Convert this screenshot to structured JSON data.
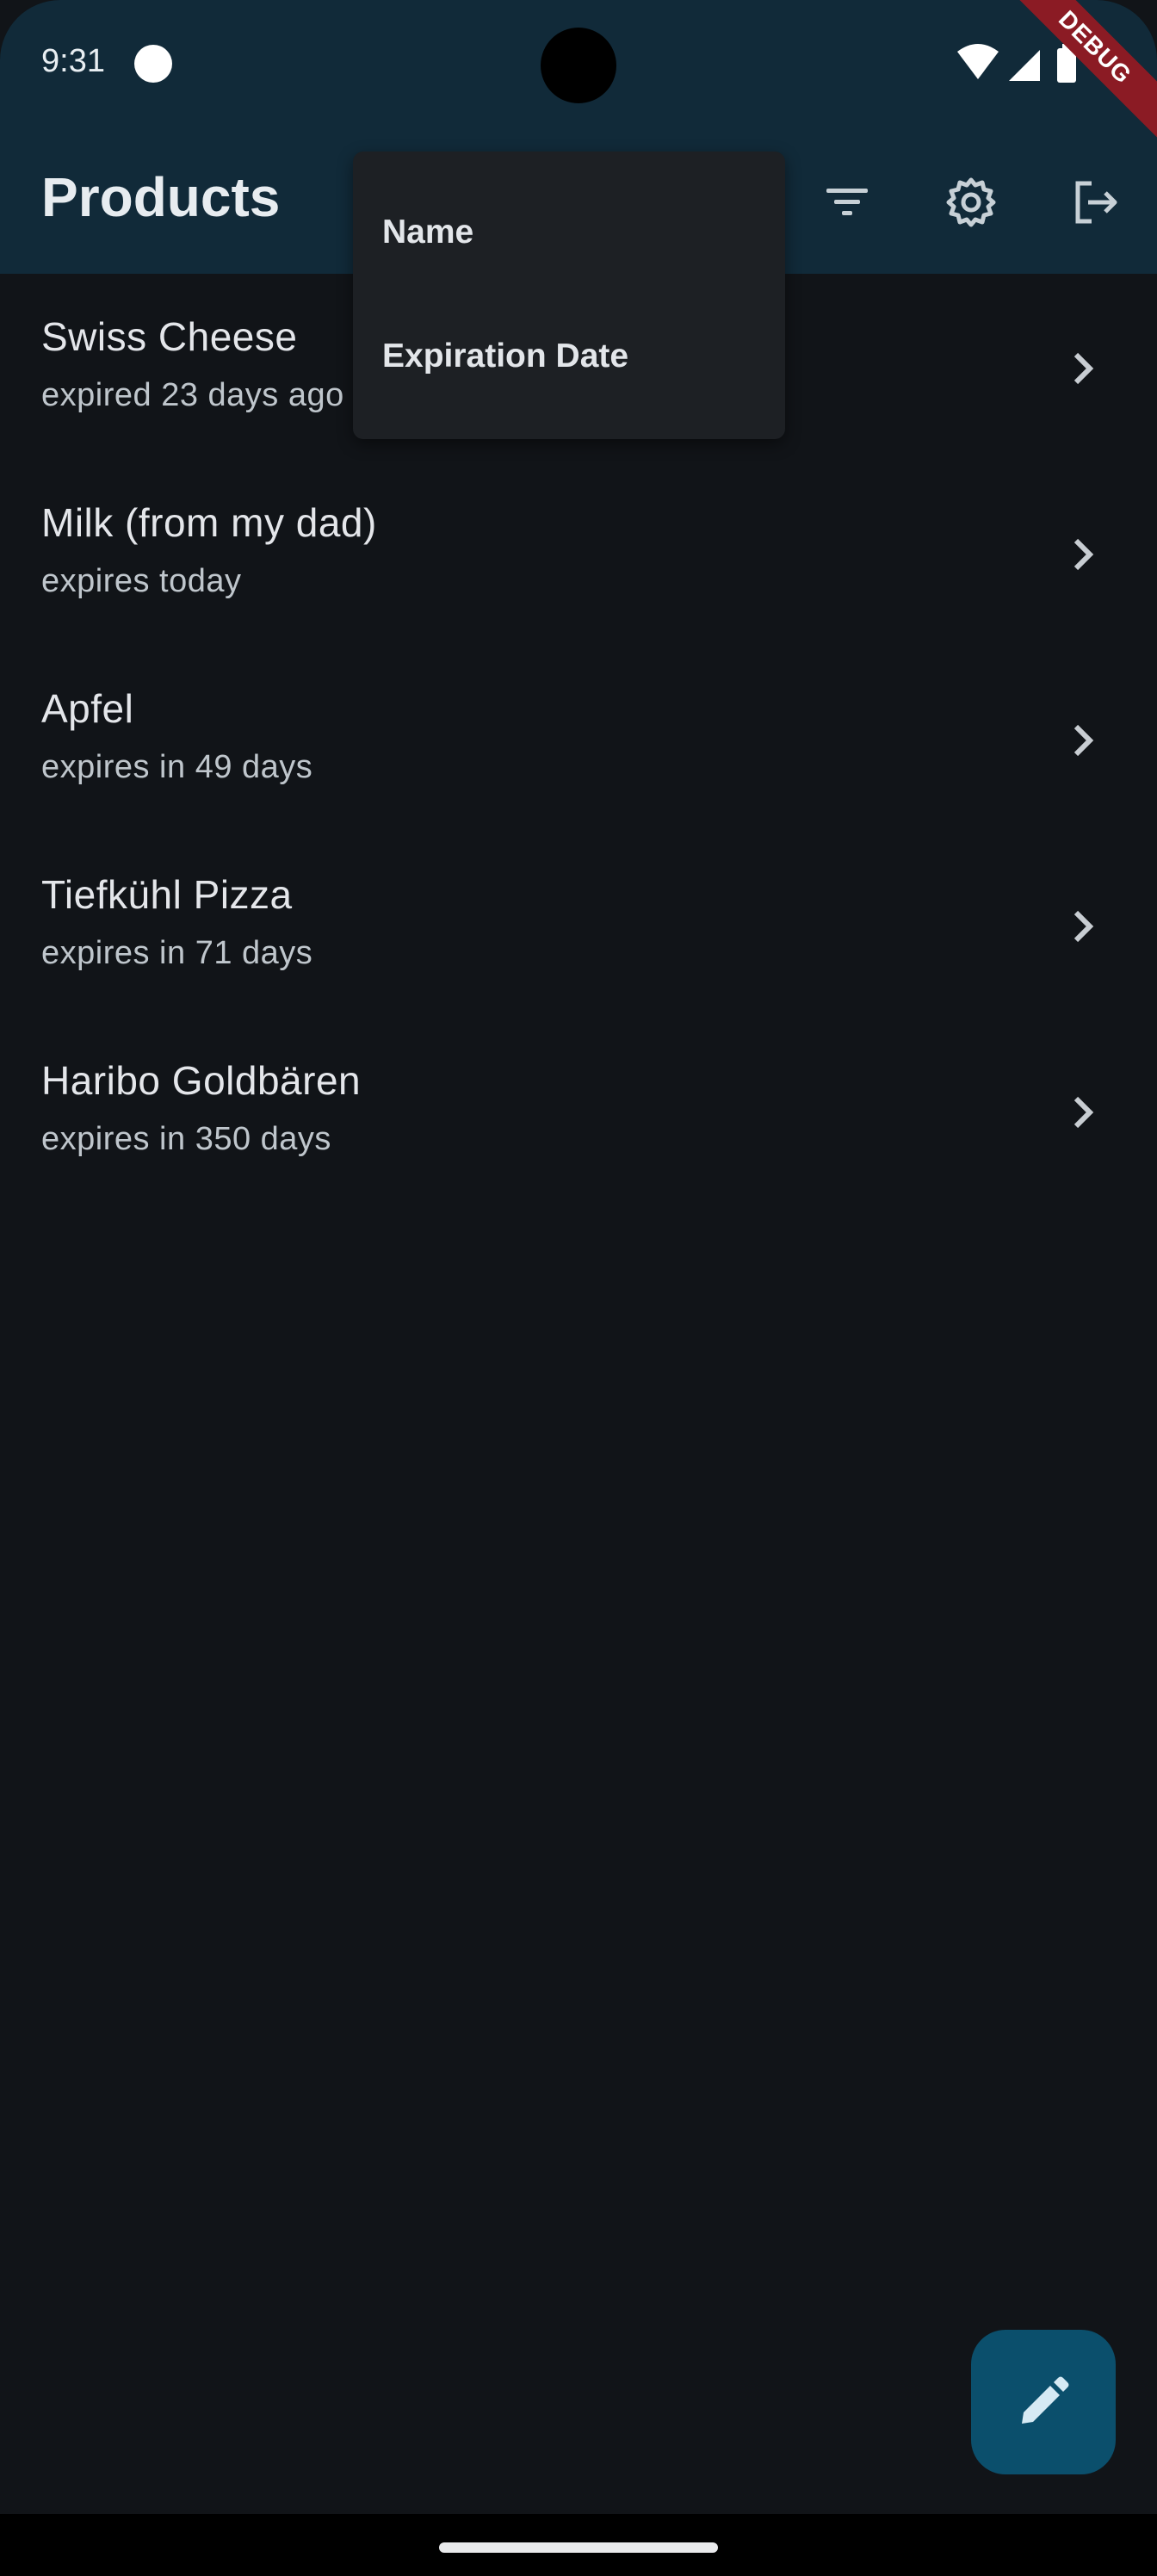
{
  "status_bar": {
    "time": "9:31",
    "debug_label": "DEBUG"
  },
  "app_bar": {
    "title": "Products",
    "icons": [
      "filter-icon",
      "gear-icon",
      "logout-icon"
    ]
  },
  "sort_menu": {
    "items": [
      {
        "label": "Name"
      },
      {
        "label": "Expiration Date"
      }
    ]
  },
  "products": [
    {
      "name": "Swiss Cheese",
      "expiration": "expired 23 days ago"
    },
    {
      "name": "Milk (from my dad)",
      "expiration": "expires today"
    },
    {
      "name": "Apfel",
      "expiration": "expires in 49 days"
    },
    {
      "name": "Tiefkühl Pizza",
      "expiration": "expires in 71 days"
    },
    {
      "name": "Haribo Goldbären",
      "expiration": "expires in 350 days"
    }
  ],
  "fab": {
    "icon": "edit-icon"
  },
  "colors": {
    "background": "#111418",
    "app_bar": "#112a39",
    "fab": "#0b4f6c",
    "menu": "#1d2024",
    "debug_banner": "#8b1b24"
  }
}
